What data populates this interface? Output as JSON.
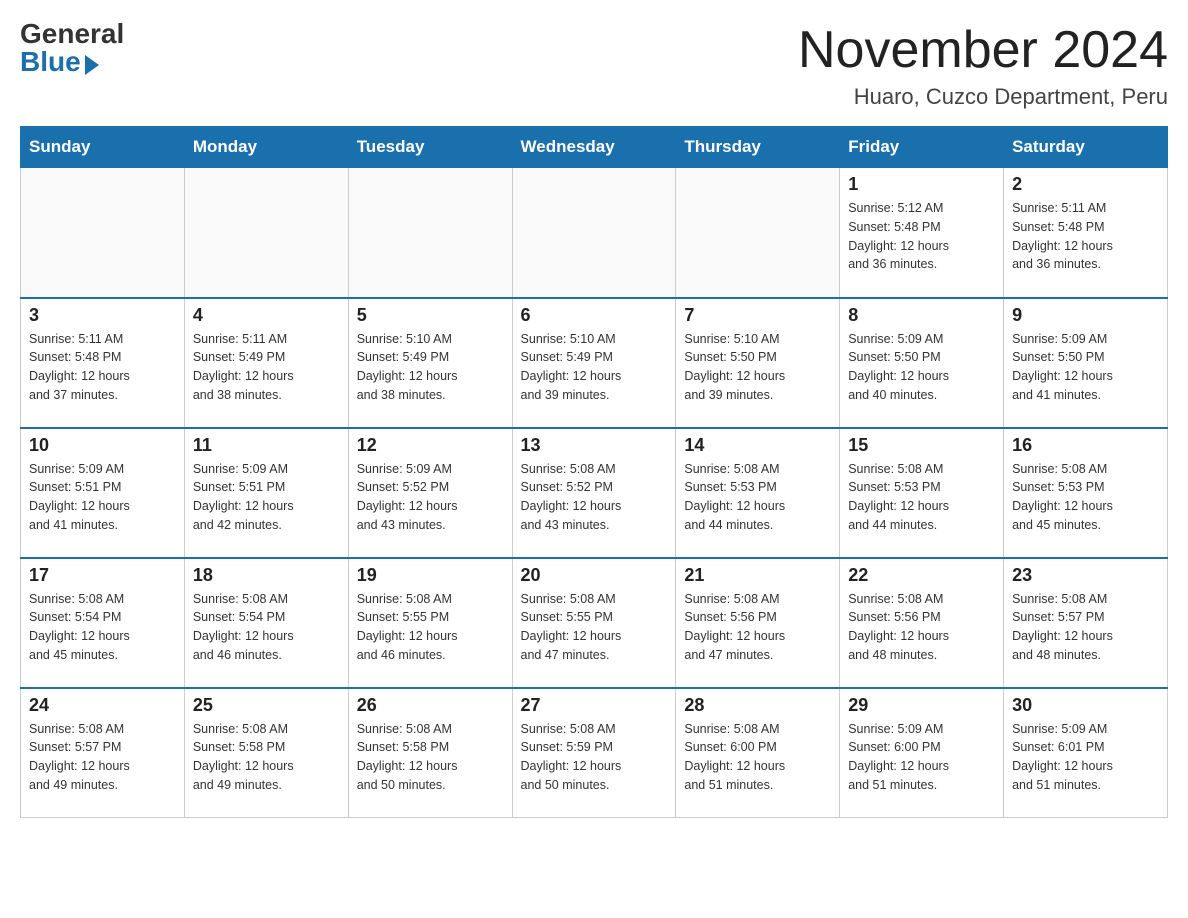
{
  "header": {
    "logo": {
      "general": "General",
      "blue": "Blue"
    },
    "month_title": "November 2024",
    "location": "Huaro, Cuzco Department, Peru"
  },
  "days_of_week": [
    "Sunday",
    "Monday",
    "Tuesday",
    "Wednesday",
    "Thursday",
    "Friday",
    "Saturday"
  ],
  "weeks": [
    [
      {
        "day": "",
        "info": ""
      },
      {
        "day": "",
        "info": ""
      },
      {
        "day": "",
        "info": ""
      },
      {
        "day": "",
        "info": ""
      },
      {
        "day": "",
        "info": ""
      },
      {
        "day": "1",
        "info": "Sunrise: 5:12 AM\nSunset: 5:48 PM\nDaylight: 12 hours\nand 36 minutes."
      },
      {
        "day": "2",
        "info": "Sunrise: 5:11 AM\nSunset: 5:48 PM\nDaylight: 12 hours\nand 36 minutes."
      }
    ],
    [
      {
        "day": "3",
        "info": "Sunrise: 5:11 AM\nSunset: 5:48 PM\nDaylight: 12 hours\nand 37 minutes."
      },
      {
        "day": "4",
        "info": "Sunrise: 5:11 AM\nSunset: 5:49 PM\nDaylight: 12 hours\nand 38 minutes."
      },
      {
        "day": "5",
        "info": "Sunrise: 5:10 AM\nSunset: 5:49 PM\nDaylight: 12 hours\nand 38 minutes."
      },
      {
        "day": "6",
        "info": "Sunrise: 5:10 AM\nSunset: 5:49 PM\nDaylight: 12 hours\nand 39 minutes."
      },
      {
        "day": "7",
        "info": "Sunrise: 5:10 AM\nSunset: 5:50 PM\nDaylight: 12 hours\nand 39 minutes."
      },
      {
        "day": "8",
        "info": "Sunrise: 5:09 AM\nSunset: 5:50 PM\nDaylight: 12 hours\nand 40 minutes."
      },
      {
        "day": "9",
        "info": "Sunrise: 5:09 AM\nSunset: 5:50 PM\nDaylight: 12 hours\nand 41 minutes."
      }
    ],
    [
      {
        "day": "10",
        "info": "Sunrise: 5:09 AM\nSunset: 5:51 PM\nDaylight: 12 hours\nand 41 minutes."
      },
      {
        "day": "11",
        "info": "Sunrise: 5:09 AM\nSunset: 5:51 PM\nDaylight: 12 hours\nand 42 minutes."
      },
      {
        "day": "12",
        "info": "Sunrise: 5:09 AM\nSunset: 5:52 PM\nDaylight: 12 hours\nand 43 minutes."
      },
      {
        "day": "13",
        "info": "Sunrise: 5:08 AM\nSunset: 5:52 PM\nDaylight: 12 hours\nand 43 minutes."
      },
      {
        "day": "14",
        "info": "Sunrise: 5:08 AM\nSunset: 5:53 PM\nDaylight: 12 hours\nand 44 minutes."
      },
      {
        "day": "15",
        "info": "Sunrise: 5:08 AM\nSunset: 5:53 PM\nDaylight: 12 hours\nand 44 minutes."
      },
      {
        "day": "16",
        "info": "Sunrise: 5:08 AM\nSunset: 5:53 PM\nDaylight: 12 hours\nand 45 minutes."
      }
    ],
    [
      {
        "day": "17",
        "info": "Sunrise: 5:08 AM\nSunset: 5:54 PM\nDaylight: 12 hours\nand 45 minutes."
      },
      {
        "day": "18",
        "info": "Sunrise: 5:08 AM\nSunset: 5:54 PM\nDaylight: 12 hours\nand 46 minutes."
      },
      {
        "day": "19",
        "info": "Sunrise: 5:08 AM\nSunset: 5:55 PM\nDaylight: 12 hours\nand 46 minutes."
      },
      {
        "day": "20",
        "info": "Sunrise: 5:08 AM\nSunset: 5:55 PM\nDaylight: 12 hours\nand 47 minutes."
      },
      {
        "day": "21",
        "info": "Sunrise: 5:08 AM\nSunset: 5:56 PM\nDaylight: 12 hours\nand 47 minutes."
      },
      {
        "day": "22",
        "info": "Sunrise: 5:08 AM\nSunset: 5:56 PM\nDaylight: 12 hours\nand 48 minutes."
      },
      {
        "day": "23",
        "info": "Sunrise: 5:08 AM\nSunset: 5:57 PM\nDaylight: 12 hours\nand 48 minutes."
      }
    ],
    [
      {
        "day": "24",
        "info": "Sunrise: 5:08 AM\nSunset: 5:57 PM\nDaylight: 12 hours\nand 49 minutes."
      },
      {
        "day": "25",
        "info": "Sunrise: 5:08 AM\nSunset: 5:58 PM\nDaylight: 12 hours\nand 49 minutes."
      },
      {
        "day": "26",
        "info": "Sunrise: 5:08 AM\nSunset: 5:58 PM\nDaylight: 12 hours\nand 50 minutes."
      },
      {
        "day": "27",
        "info": "Sunrise: 5:08 AM\nSunset: 5:59 PM\nDaylight: 12 hours\nand 50 minutes."
      },
      {
        "day": "28",
        "info": "Sunrise: 5:08 AM\nSunset: 6:00 PM\nDaylight: 12 hours\nand 51 minutes."
      },
      {
        "day": "29",
        "info": "Sunrise: 5:09 AM\nSunset: 6:00 PM\nDaylight: 12 hours\nand 51 minutes."
      },
      {
        "day": "30",
        "info": "Sunrise: 5:09 AM\nSunset: 6:01 PM\nDaylight: 12 hours\nand 51 minutes."
      }
    ]
  ]
}
